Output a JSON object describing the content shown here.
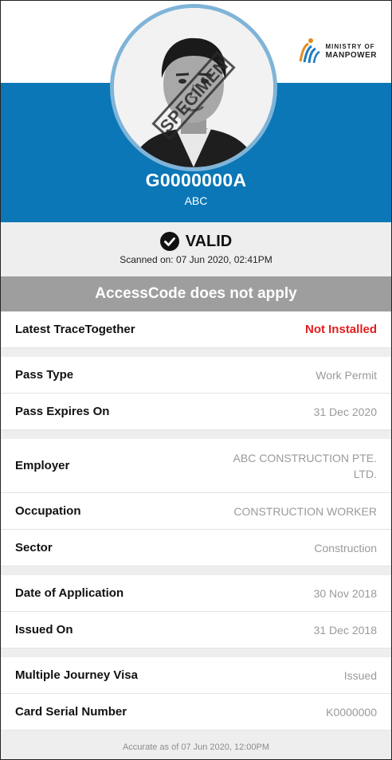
{
  "header": {
    "logo_line1": "MINISTRY OF",
    "logo_line2": "MANPOWER",
    "photo_watermark": "SPECIMEN",
    "fin": "G0000000A",
    "name": "ABC"
  },
  "status": {
    "label": "VALID",
    "scanned": "Scanned on: 07 Jun 2020, 02:41PM"
  },
  "access_code": "AccessCode does not apply",
  "details": {
    "trace_label": "Latest TraceTogether",
    "trace_value": "Not Installed",
    "pass_type_label": "Pass Type",
    "pass_type_value": "Work Permit",
    "expires_label": "Pass Expires On",
    "expires_value": "31 Dec 2020",
    "employer_label": "Employer",
    "employer_value_line1": "ABC CONSTRUCTION PTE.",
    "employer_value_line2": "LTD.",
    "occupation_label": "Occupation",
    "occupation_value": "CONSTRUCTION WORKER",
    "sector_label": "Sector",
    "sector_value": "Construction",
    "application_label": "Date of Application",
    "application_value": "30 Nov 2018",
    "issued_label": "Issued On",
    "issued_value": "31 Dec 2018",
    "visa_label": "Multiple Journey Visa",
    "visa_value": "Issued",
    "serial_label": "Card Serial Number",
    "serial_value": "K0000000"
  },
  "footer": "Accurate as of 07 Jun 2020, 12:00PM",
  "colors": {
    "header_blue": "#0b77b7",
    "alert_red": "#e21d1d",
    "banner_grey": "#9e9e9e",
    "section_grey": "#eeeeee"
  }
}
